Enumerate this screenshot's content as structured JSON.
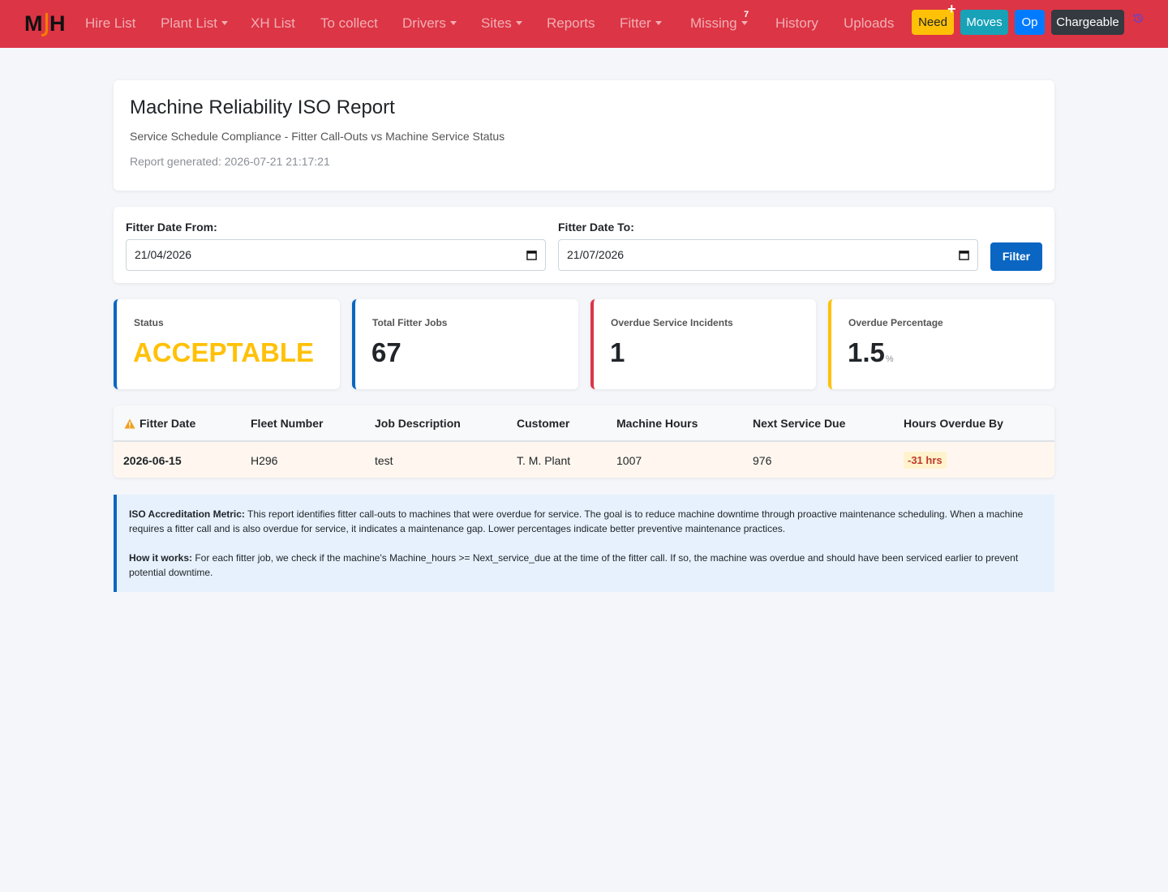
{
  "brand": {
    "logo_text": "MJH"
  },
  "nav": {
    "items": [
      {
        "label": "Hire List",
        "dropdown": false
      },
      {
        "label": "Plant List",
        "dropdown": true
      },
      {
        "label": "XH List",
        "dropdown": false
      },
      {
        "label": "To collect",
        "dropdown": false
      },
      {
        "label": "Drivers",
        "dropdown": true
      },
      {
        "label": "Sites",
        "dropdown": true
      },
      {
        "label": "Reports",
        "dropdown": false
      },
      {
        "label": "Fitter",
        "dropdown": true
      },
      {
        "label": "Missing",
        "dropdown": true,
        "badge": "7"
      },
      {
        "label": "History",
        "dropdown": false
      },
      {
        "label": "Uploads",
        "dropdown": false
      }
    ],
    "buttons": {
      "need": "Need",
      "need_icon": "plus-icon",
      "moves": "Moves",
      "op": "Op",
      "chargeable": "Chargeable"
    },
    "history_icon": "history-icon",
    "colors": {
      "navbar": "#dc3545",
      "need": "#ffc107",
      "moves": "#17a2b8",
      "op": "#007bff",
      "chargeable": "#343a40"
    }
  },
  "header": {
    "title": "Machine Reliability ISO Report",
    "subtitle": "Service Schedule Compliance - Fitter Call-Outs vs Machine Service Status",
    "generated": "Report generated: 2026-07-21 21:17:21"
  },
  "filter": {
    "from_label": "Fitter Date From:",
    "from_value": "21/04/2026",
    "to_label": "Fitter Date To:",
    "to_value": "21/07/2026",
    "button": "Filter",
    "calendar_icon": "calendar-icon"
  },
  "stats": {
    "status": {
      "label": "Status",
      "value": "ACCEPTABLE",
      "color": "#ffc107",
      "accent": "#0a66c2"
    },
    "total_jobs": {
      "label": "Total Fitter Jobs",
      "value": "67",
      "accent": "#0a66c2"
    },
    "overdue_incidents": {
      "label": "Overdue Service Incidents",
      "value": "1",
      "accent": "#dc3545"
    },
    "overdue_percentage": {
      "label": "Overdue Percentage",
      "value": "1.5",
      "unit": "%",
      "accent": "#ffc107"
    }
  },
  "table": {
    "header_icon": "warning-icon",
    "columns": [
      "Fitter Date",
      "Fleet Number",
      "Job Description",
      "Customer",
      "Machine Hours",
      "Next Service Due",
      "Hours Overdue By"
    ],
    "rows": [
      {
        "fitter_date": "2026-06-15",
        "fleet_number": "H296",
        "job_description": "test",
        "customer": "T. M. Plant",
        "machine_hours": "1007",
        "next_service_due": "976",
        "hours_overdue_by": "-31 hrs"
      }
    ]
  },
  "info": {
    "metric_title": "ISO Accreditation Metric:",
    "metric_text": " This report identifies fitter call-outs to machines that were overdue for service. The goal is to reduce machine downtime through proactive maintenance scheduling. When a machine requires a fitter call and is also overdue for service, it indicates a maintenance gap. Lower percentages indicate better preventive maintenance practices.",
    "how_title": "How it works:",
    "how_text": " For each fitter job, we check if the machine's Machine_hours >= Next_service_due at the time of the fitter call. If so, the machine was overdue and should have been serviced earlier to prevent potential downtime."
  }
}
